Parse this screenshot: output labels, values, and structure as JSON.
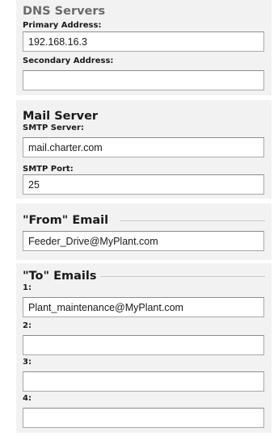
{
  "dns": {
    "title": "DNS Servers",
    "primary_label": "Primary Address:",
    "primary_value": "192.168.16.3",
    "secondary_label": "Secondary Address:",
    "secondary_value": ""
  },
  "mail": {
    "title": "Mail Server",
    "smtp_server_label": "SMTP Server:",
    "smtp_server_value": "mail.charter.com",
    "smtp_port_label": "SMTP Port:",
    "smtp_port_value": "25"
  },
  "from": {
    "title": "\"From\" Email",
    "value": "Feeder_Drive@MyPlant.com"
  },
  "to": {
    "title": "\"To\" Emails",
    "emails": [
      {
        "label": "1:",
        "value": "Plant_maintenance@MyPlant.com"
      },
      {
        "label": "2:",
        "value": ""
      },
      {
        "label": "3:",
        "value": ""
      },
      {
        "label": "4:",
        "value": ""
      }
    ]
  },
  "colors": {
    "section_background": "#f2f2f2",
    "dns_title": "#6a6a6a",
    "section_title": "#1a1a1a",
    "input_border": "#a8a8a8"
  }
}
